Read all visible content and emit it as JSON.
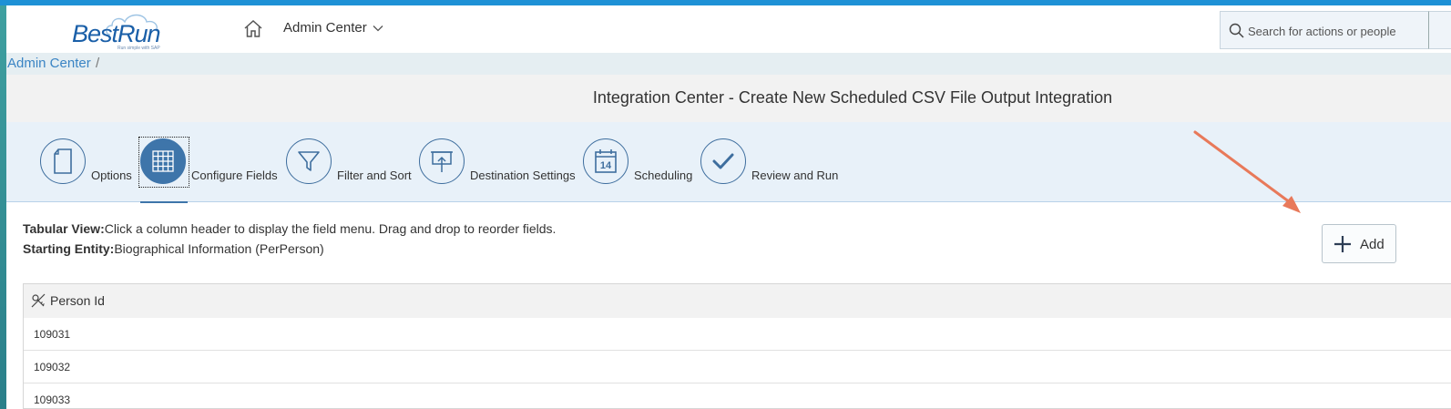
{
  "brand": {
    "name": "BestRun",
    "tagline": "Run simple with SAP"
  },
  "header": {
    "menu_label": "Admin Center",
    "search": {
      "placeholder": "Search for actions or people"
    }
  },
  "breadcrumb": {
    "items": [
      "Admin Center"
    ],
    "separator": "/"
  },
  "page": {
    "title": "Integration Center - Create New Scheduled CSV File Output Integration"
  },
  "steps": [
    {
      "label": "Options",
      "icon": "document-icon",
      "active": false
    },
    {
      "label": "Configure Fields",
      "icon": "grid-icon",
      "active": true
    },
    {
      "label": "Filter and Sort",
      "icon": "funnel-icon",
      "active": false
    },
    {
      "label": "Destination Settings",
      "icon": "presentation-upload-icon",
      "active": false
    },
    {
      "label": "Scheduling",
      "icon": "calendar-icon",
      "active": false,
      "calendar_day": "14"
    },
    {
      "label": "Review and Run",
      "icon": "checkmark-icon",
      "active": false
    }
  ],
  "info": {
    "tabular_label": "Tabular View:",
    "tabular_text": "Click a column header to display the field menu. Drag and drop to reorder fields.",
    "entity_label": "Starting Entity:",
    "entity_text": "Biographical Information (PerPerson)"
  },
  "actions": {
    "add_label": "Add"
  },
  "table": {
    "columns": [
      {
        "label": "Person Id",
        "icon": "key-field-icon"
      }
    ],
    "rows": [
      [
        "109031"
      ],
      [
        "109032"
      ],
      [
        "109033"
      ]
    ]
  },
  "colors": {
    "accent": "#1e91d6",
    "step_active": "#3e75aa",
    "link": "#3a84c4",
    "annotation_arrow": "#e8795a"
  }
}
